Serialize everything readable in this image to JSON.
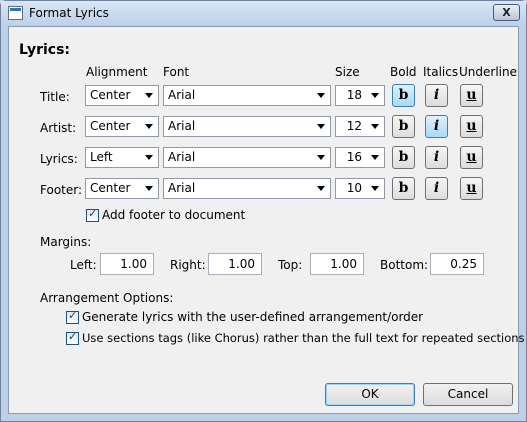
{
  "window": {
    "title": "Format Lyrics",
    "close_glyph": "X"
  },
  "lyrics": {
    "heading": "Lyrics:",
    "columns": {
      "alignment": "Alignment",
      "font": "Font",
      "size": "Size",
      "bold": "Bold",
      "italics": "Italics",
      "underline": "Underline"
    },
    "rows": [
      {
        "label": "Title:",
        "alignment": "Center",
        "font": "Arial",
        "size": "18",
        "bold": true,
        "italic": false,
        "underline": false
      },
      {
        "label": "Artist:",
        "alignment": "Center",
        "font": "Arial",
        "size": "12",
        "bold": false,
        "italic": true,
        "underline": false
      },
      {
        "label": "Lyrics:",
        "alignment": "Left",
        "font": "Arial",
        "size": "16",
        "bold": false,
        "italic": false,
        "underline": false
      },
      {
        "label": "Footer:",
        "alignment": "Center",
        "font": "Arial",
        "size": "10",
        "bold": false,
        "italic": false,
        "underline": false
      }
    ],
    "glyphs": {
      "bold": "b",
      "italic": "i",
      "underline": "u"
    },
    "add_footer": {
      "label": "Add footer to document",
      "checked": true
    }
  },
  "margins": {
    "heading": "Margins:",
    "left": {
      "label": "Left:",
      "value": "1.00"
    },
    "right": {
      "label": "Right:",
      "value": "1.00"
    },
    "top": {
      "label": "Top:",
      "value": "1.00"
    },
    "bottom": {
      "label": "Bottom:",
      "value": "0.25"
    }
  },
  "arrangement": {
    "heading": "Arrangement Options:",
    "option1": {
      "label": "Generate lyrics with the user-defined arrangement/order",
      "checked": true
    },
    "option2": {
      "label": "Use sections tags (like Chorus) rather than the full text for repeated sections",
      "checked": true
    }
  },
  "buttons": {
    "ok": "OK",
    "cancel": "Cancel"
  }
}
